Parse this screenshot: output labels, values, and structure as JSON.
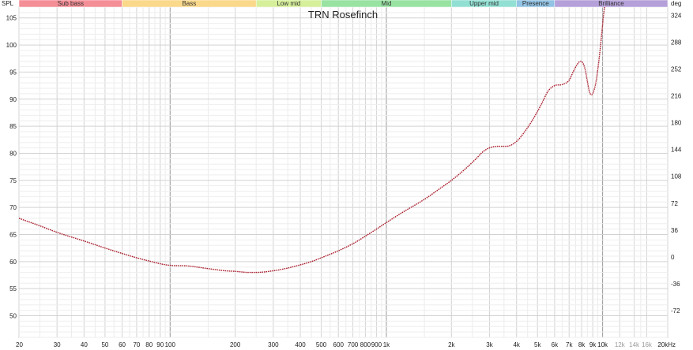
{
  "chart_data": {
    "type": "line",
    "title": "TRN Rosefinch",
    "xlabel": "",
    "ylabel": "SPL",
    "y2label": "deg",
    "x_scale": "log",
    "xlim": [
      20,
      20000
    ],
    "ylim": [
      46,
      107
    ],
    "y2lim": [
      -108,
      335
    ],
    "grid": true,
    "legend": "none",
    "x_ticks": [
      {
        "v": 20,
        "label": "20"
      },
      {
        "v": 30,
        "label": "30"
      },
      {
        "v": 40,
        "label": "40"
      },
      {
        "v": 50,
        "label": "50"
      },
      {
        "v": 60,
        "label": "60"
      },
      {
        "v": 70,
        "label": "70"
      },
      {
        "v": 80,
        "label": "80"
      },
      {
        "v": 90,
        "label": "90"
      },
      {
        "v": 100,
        "label": "100"
      },
      {
        "v": 200,
        "label": "200"
      },
      {
        "v": 300,
        "label": "300"
      },
      {
        "v": 400,
        "label": "400"
      },
      {
        "v": 500,
        "label": "500"
      },
      {
        "v": 600,
        "label": "600"
      },
      {
        "v": 700,
        "label": "700"
      },
      {
        "v": 800,
        "label": "800"
      },
      {
        "v": 900,
        "label": "900"
      },
      {
        "v": 1000,
        "label": "1k"
      },
      {
        "v": 2000,
        "label": "2k"
      },
      {
        "v": 3000,
        "label": "3k"
      },
      {
        "v": 4000,
        "label": "4k"
      },
      {
        "v": 5000,
        "label": "5k"
      },
      {
        "v": 6000,
        "label": "6k"
      },
      {
        "v": 7000,
        "label": "7k"
      },
      {
        "v": 8000,
        "label": "8k"
      },
      {
        "v": 9000,
        "label": "9k"
      },
      {
        "v": 10000,
        "label": "10k"
      },
      {
        "v": 12000,
        "label": "12k",
        "light": true
      },
      {
        "v": 14000,
        "label": "14k",
        "light": true
      },
      {
        "v": 16000,
        "label": "16k",
        "light": true
      },
      {
        "v": 20000,
        "label": "20kHz"
      }
    ],
    "y_ticks": [
      50,
      55,
      60,
      65,
      70,
      75,
      80,
      85,
      90,
      95,
      100,
      105
    ],
    "y2_ticks": [
      -72,
      -36,
      0,
      36,
      72,
      108,
      144,
      180,
      216,
      252,
      288,
      324
    ],
    "bands": [
      {
        "label": "Sub bass",
        "from": 20,
        "to": 60,
        "color": "#f48f97"
      },
      {
        "label": "Bass",
        "from": 60,
        "to": 250,
        "color": "#fad98b"
      },
      {
        "label": "Low mid",
        "from": 250,
        "to": 500,
        "color": "#d6ef9a"
      },
      {
        "label": "Mid",
        "from": 500,
        "to": 2000,
        "color": "#99e3a2"
      },
      {
        "label": "Upper mid",
        "from": 2000,
        "to": 4000,
        "color": "#92e0d3"
      },
      {
        "label": "Presence",
        "from": 4000,
        "to": 6000,
        "color": "#92c3e4"
      },
      {
        "label": "Brilliance",
        "from": 6000,
        "to": 20000,
        "color": "#b5a0d9"
      }
    ],
    "series": [
      {
        "color": "#a81b2a",
        "points": [
          [
            20,
            68.0
          ],
          [
            25,
            66.6
          ],
          [
            30,
            65.4
          ],
          [
            40,
            63.8
          ],
          [
            50,
            62.5
          ],
          [
            60,
            61.5
          ],
          [
            70,
            60.7
          ],
          [
            80,
            60.1
          ],
          [
            90,
            59.6
          ],
          [
            100,
            59.3
          ],
          [
            120,
            59.2
          ],
          [
            150,
            58.7
          ],
          [
            180,
            58.3
          ],
          [
            200,
            58.2
          ],
          [
            230,
            58.0
          ],
          [
            250,
            58.0
          ],
          [
            300,
            58.3
          ],
          [
            350,
            58.8
          ],
          [
            400,
            59.4
          ],
          [
            450,
            60.0
          ],
          [
            500,
            60.7
          ],
          [
            600,
            62.0
          ],
          [
            700,
            63.3
          ],
          [
            800,
            64.7
          ],
          [
            900,
            66.0
          ],
          [
            1000,
            67.2
          ],
          [
            1200,
            69.2
          ],
          [
            1500,
            71.5
          ],
          [
            1800,
            73.7
          ],
          [
            2000,
            75.0
          ],
          [
            2300,
            77.0
          ],
          [
            2600,
            79.0
          ],
          [
            2800,
            80.3
          ],
          [
            3000,
            81.0
          ],
          [
            3300,
            81.3
          ],
          [
            3600,
            81.3
          ],
          [
            4000,
            82.2
          ],
          [
            4400,
            84.2
          ],
          [
            4800,
            86.5
          ],
          [
            5200,
            89.0
          ],
          [
            5600,
            91.5
          ],
          [
            6000,
            92.5
          ],
          [
            6500,
            92.7
          ],
          [
            7000,
            93.5
          ],
          [
            7300,
            95.0
          ],
          [
            7600,
            96.3
          ],
          [
            7900,
            97.0
          ],
          [
            8100,
            96.7
          ],
          [
            8300,
            95.5
          ],
          [
            8500,
            93.3
          ],
          [
            8700,
            91.3
          ],
          [
            8900,
            90.8
          ],
          [
            9100,
            91.5
          ],
          [
            9300,
            93.0
          ],
          [
            9500,
            95.5
          ],
          [
            9700,
            98.5
          ],
          [
            9900,
            102.0
          ],
          [
            10100,
            105.5
          ],
          [
            10300,
            108.0
          ]
        ]
      }
    ]
  }
}
